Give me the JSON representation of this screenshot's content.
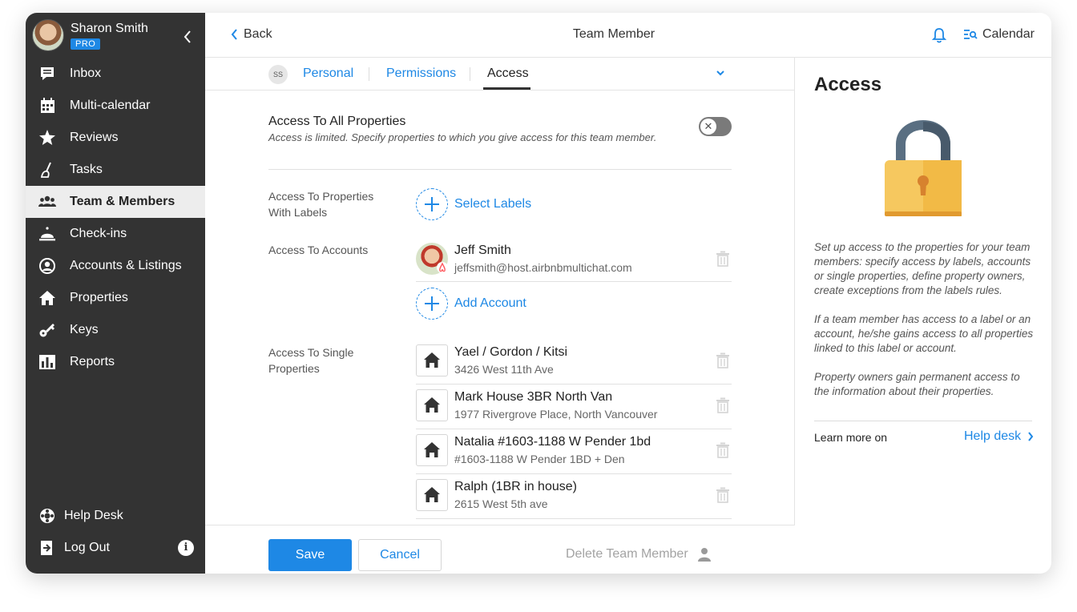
{
  "user": {
    "name": "Sharon Smith",
    "badge": "PRO"
  },
  "sidebar": {
    "items": [
      {
        "label": "Inbox",
        "icon": "inbox-icon"
      },
      {
        "label": "Multi-calendar",
        "icon": "calendar-grid-icon"
      },
      {
        "label": "Reviews",
        "icon": "star-icon"
      },
      {
        "label": "Tasks",
        "icon": "broom-icon"
      },
      {
        "label": "Team & Members",
        "icon": "team-icon",
        "active": true
      },
      {
        "label": "Check-ins",
        "icon": "bell-desk-icon"
      },
      {
        "label": "Accounts & Listings",
        "icon": "account-circle-icon"
      },
      {
        "label": "Properties",
        "icon": "home-icon"
      },
      {
        "label": "Keys",
        "icon": "key-icon"
      },
      {
        "label": "Reports",
        "icon": "bar-chart-icon"
      }
    ],
    "bottom": [
      {
        "label": "Help Desk",
        "icon": "lifebuoy-icon"
      },
      {
        "label": "Log Out",
        "icon": "logout-icon"
      }
    ]
  },
  "header": {
    "back": "Back",
    "title": "Team Member",
    "calendar": "Calendar"
  },
  "tabs": {
    "initials": "SS",
    "personal": "Personal",
    "permissions": "Permissions",
    "access": "Access"
  },
  "access_all": {
    "title": "Access To All Properties",
    "subtitle": "Access is limited. Specify properties to which you give access for this team member.",
    "enabled": false
  },
  "labels_section": {
    "label": "Access To Properties With Labels",
    "action": "Select Labels"
  },
  "accounts_section": {
    "label": "Access To Accounts",
    "accounts": [
      {
        "name": "Jeff Smith",
        "email": "jeffsmith@host.airbnbmultichat.com"
      }
    ],
    "action": "Add Account"
  },
  "properties_section": {
    "label": "Access To Single Properties",
    "properties": [
      {
        "name": "Yael / Gordon / Kitsi",
        "address": "3426 West 11th Ave"
      },
      {
        "name": "Mark House 3BR North Van",
        "address": "1977 Rivergrove Place, North Vancouver"
      },
      {
        "name": "Natalia #1603-1188 W Pender 1bd",
        "address": "#1603-1188 W Pender 1BD + Den"
      },
      {
        "name": "Ralph (1BR in house)",
        "address": "2615 West 5th ave"
      }
    ]
  },
  "footer": {
    "save": "Save",
    "cancel": "Cancel",
    "delete": "Delete Team Member"
  },
  "panel": {
    "title": "Access",
    "paragraphs": [
      "Set up access to the properties for your team members: specify access by labels, accounts or single properties, define property owners, create exceptions from the labels rules.",
      "If a team member has access to a label or an account, he/she gains access to all properties linked to this label or account.",
      "Property owners gain permanent access to the information about their properties."
    ],
    "learn_more": "Learn more on",
    "help_link": "Help desk"
  },
  "colors": {
    "accent": "#1e88e5",
    "sidebar": "#333333",
    "lock_body": "#f6c85f",
    "lock_shackle": "#5a6f82"
  }
}
